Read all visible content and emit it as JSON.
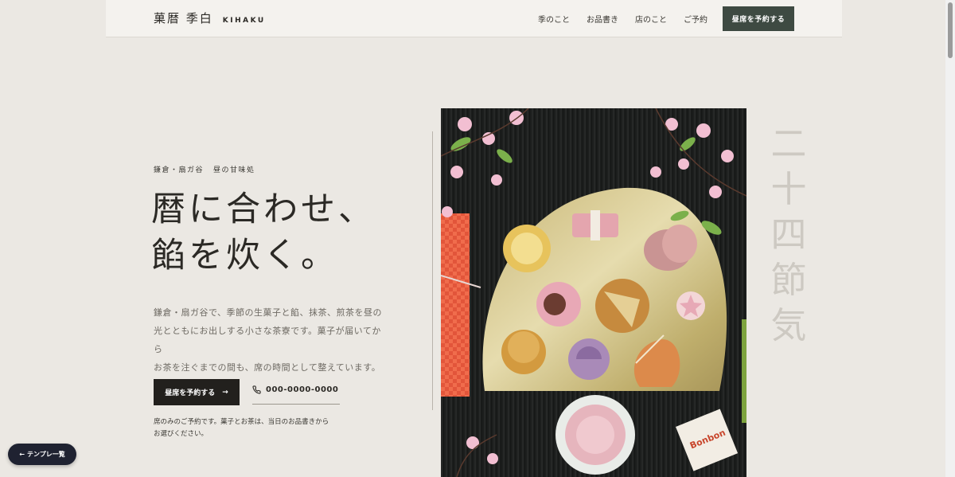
{
  "header": {
    "brand_jp": "菓暦 季白",
    "brand_en": "KIHAKU",
    "nav": [
      "季のこと",
      "お品書き",
      "店のこと",
      "ご予約"
    ],
    "cta_label": "昼席を予約する"
  },
  "hero": {
    "eyebrow_place": "鎌倉・扇ガ谷",
    "eyebrow_desc": "昼の甘味処",
    "headline_line1": "暦に合わせ、",
    "headline_line2": "餡を炊く。",
    "lead_line1": "鎌倉・扇ガ谷で、季節の生菓子と餡、抹茶、煎茶を昼の",
    "lead_line2": "光とともにお出しする小さな茶寮です。菓子が届いてから",
    "lead_line3": "お茶を注ぐまでの間も、席の時間として整えています。",
    "cta_label": "昼席を予約する",
    "cta_arrow": "→",
    "phone": "000-0000-0000",
    "note_line1": "席のみのご予約です。菓子とお茶は、当日のお品書きから",
    "note_line2": "お選びください。",
    "vertical_text": [
      "二",
      "十",
      "四",
      "節",
      "気"
    ]
  },
  "back_button": {
    "arrow": "←",
    "label": "テンプレ一覧"
  },
  "colors": {
    "background": "#ebe8e3",
    "header_bg": "#f4f2ee",
    "accent_green": "#3e4a42",
    "dark_button": "#22201d",
    "back_button": "#1f2231"
  }
}
